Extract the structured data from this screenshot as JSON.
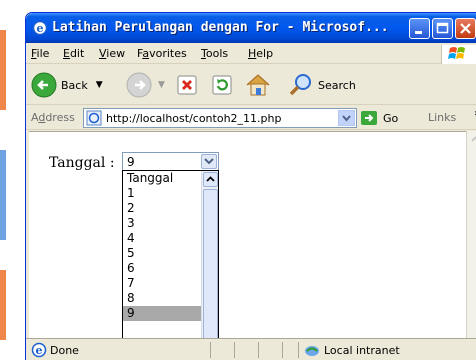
{
  "window": {
    "title": "Latihan Perulangan dengan For - Microsof..."
  },
  "menu": {
    "file": "F",
    "file_rest": "ile",
    "edit": "E",
    "edit_rest": "dit",
    "view": "V",
    "view_rest": "iew",
    "favorites_pre": "F",
    "favorites_ul": "a",
    "favorites_rest": "vorites",
    "tools": "T",
    "tools_rest": "ools",
    "help": "H",
    "help_rest": "elp"
  },
  "toolbar": {
    "back_label": "Back",
    "search_label": "Search"
  },
  "address": {
    "label_pre": "A",
    "label_ul": "d",
    "label_rest": "dress",
    "url": "http://localhost/contoh2_11.php",
    "go_label": "Go",
    "links_label": "Links"
  },
  "form": {
    "label": "Tanggal :",
    "select_value": "9",
    "options": [
      "Tanggal",
      "1",
      "2",
      "3",
      "4",
      "5",
      "6",
      "7",
      "8",
      "9"
    ],
    "selected_option": "9"
  },
  "status": {
    "text": "Done",
    "zone": "Local intranet"
  },
  "colors": {
    "titlebar": "#0058ee",
    "selection": "#a8a8a8"
  }
}
